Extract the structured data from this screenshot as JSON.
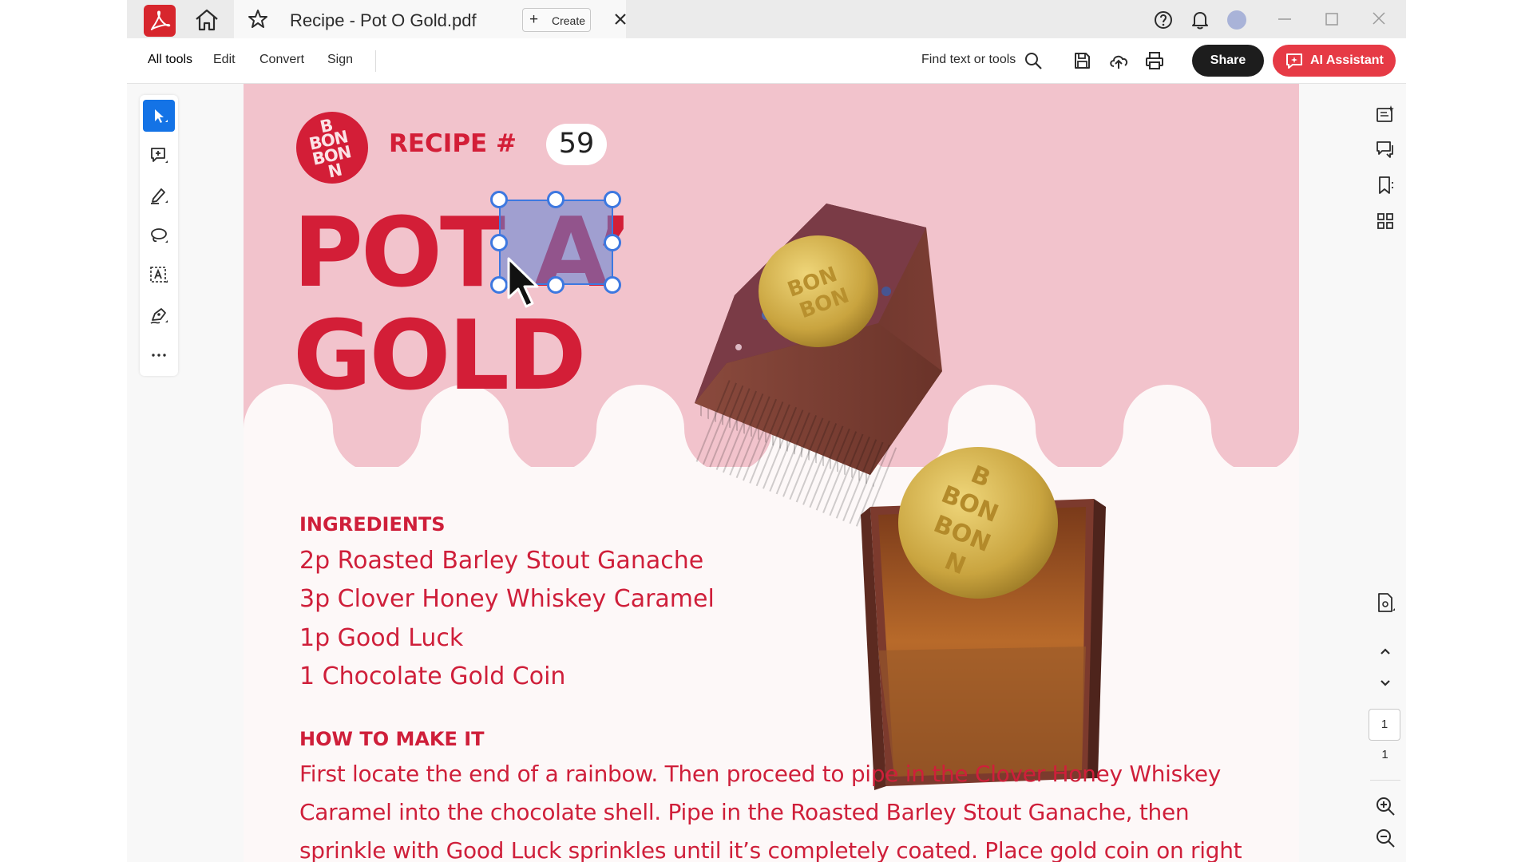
{
  "window": {
    "tab_title": "Recipe - Pot O Gold.pdf",
    "create_label": "Create"
  },
  "toolbar": {
    "menu": [
      "All tools",
      "Edit",
      "Convert",
      "Sign"
    ],
    "find_label": "Find text or tools",
    "share_label": "Share",
    "ai_label": "AI Assistant"
  },
  "navigation": {
    "current_page": "1",
    "total_pages": "1"
  },
  "document": {
    "logo_text": [
      "B",
      "BON",
      "BON",
      "N"
    ],
    "recipe_label": "RECIPE #",
    "recipe_number": "59",
    "title_line1": "POT A’",
    "title_line2": "GOLD",
    "ingredients_heading": "INGREDIENTS",
    "ingredients": [
      "2p Roasted Barley Stout Ganache",
      "3p Clover Honey Whiskey Caramel",
      "1p Good Luck",
      "1 Chocolate Gold Coin"
    ],
    "how_heading": "HOW TO MAKE IT",
    "how_lines": [
      "First locate the end of a rainbow. Then proceed to pipe in the Clover Honey Whiskey",
      "Caramel into the chocolate shell. Pipe in the Roasted Barley Stout Ganache, then",
      "sprinkle with Good Luck sprinkles until it’s completely coated. Place gold coin on right"
    ]
  },
  "colors": {
    "brand_red": "#d31e37",
    "pink_background": "#f2c3cc",
    "selection_blue": "#3d78e0",
    "ai_button": "#e63a45"
  },
  "icons": [
    "acrobat-logo-icon",
    "home-icon",
    "star-icon",
    "close-icon",
    "plus-icon",
    "help-icon",
    "bell-icon",
    "avatar",
    "minimize-icon",
    "maximize-icon",
    "window-close-icon",
    "search-icon",
    "save-icon",
    "cloud-upload-icon",
    "print-icon",
    "ai-assistant-icon",
    "select-arrow-icon",
    "add-comment-icon",
    "highlight-pen-icon",
    "lasso-icon",
    "text-select-icon",
    "sign-pen-icon",
    "more-icon",
    "edit-panel-icon",
    "comments-icon",
    "bookmark-icon",
    "thumbnails-icon",
    "page-settings-icon",
    "chevron-up-icon",
    "chevron-down-icon",
    "zoom-in-icon",
    "zoom-out-icon",
    "mouse-cursor-icon"
  ]
}
